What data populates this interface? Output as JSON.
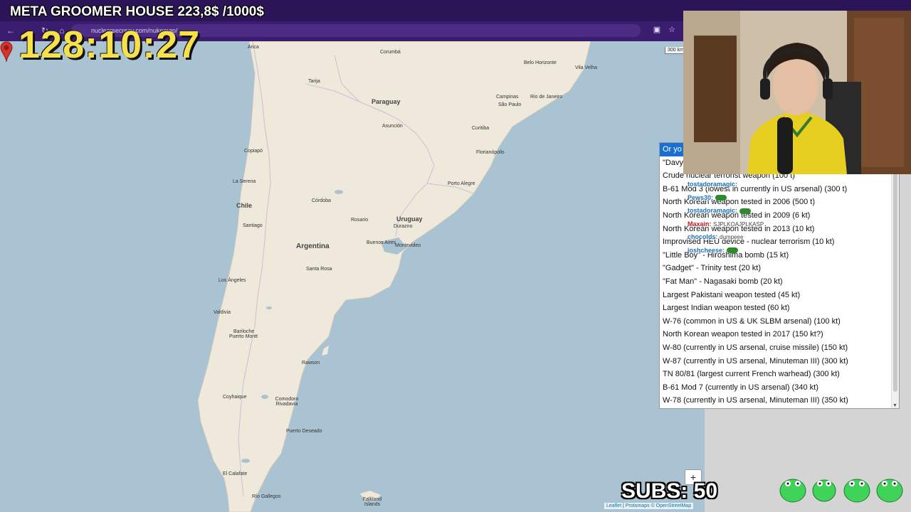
{
  "overlay": {
    "title": "META GROOMER HOUSE 223,8$ /1000$",
    "timer": "128:10:27",
    "subs": "SUBS: 50"
  },
  "browser": {
    "address": "nuclearsecrecy.com/nukemap/"
  },
  "map": {
    "scale": "300 km",
    "zoom_in": "+",
    "attribution": [
      "Leaflet",
      "Protomaps",
      "© OpenStreetMap"
    ],
    "labels": {
      "countries": [
        "Paraguay",
        "Chile",
        "Argentina",
        "Uruguay"
      ],
      "cities": [
        "Arica",
        "Corumbá",
        "Belo Horizonte",
        "Vila Velha",
        "Tarija",
        "Campinas",
        "Rio de Janeiro",
        "São Paulo",
        "Asunción",
        "Curitiba",
        "Copiapó",
        "Florianópolis",
        "La Serena",
        "Córdoba",
        "Porto Alegre",
        "Santiago",
        "Rosario",
        "Durazno",
        "Buenos Aires",
        "Montevideo",
        "Santa Rosa",
        "Los Ángeles",
        "Valdivia",
        "Bariloche",
        "Puerto Montt",
        "Rawson",
        "Coyhaique",
        "Comodoro Rivadavia",
        "Puerto Deseado",
        "El Calafate",
        "Río Gallegos",
        "Falkland Islands"
      ]
    }
  },
  "dropdown": {
    "options": [
      "Or yo",
      "\"Davy",
      "Crude nuclear terrorist weapon (100 t)",
      "B-61 Mod 3 (lowest in currently in US arsenal) (300 t)",
      "North Korean weapon tested in 2006 (500 t)",
      "North Korean weapon tested in 2009 (6 kt)",
      "North Korean weapon tested in 2013 (10 kt)",
      "Improvised HEU device - nuclear terrorism (10 kt)",
      "\"Little Boy\" - Hiroshima bomb (15 kt)",
      "\"Gadget\" - Trinity test (20 kt)",
      "\"Fat Man\" - Nagasaki bomb (20 kt)",
      "Largest Pakistani weapon tested (45 kt)",
      "Largest Indian weapon tested (60 kt)",
      "W-76 (common in US & UK SLBM arsenal) (100 kt)",
      "North Korean weapon tested in 2017 (150 kt?)",
      "W-80 (currently in US arsenal, cruise missile) (150 kt)",
      "W-87 (currently in US arsenal, Minuteman III) (300 kt)",
      "TN 80/81 (largest current French warhead) (300 kt)",
      "B-61 Mod 7 (currently in US arsenal) (340 kt)",
      "W-78 (currently in US arsenal, Minuteman III) (350 kt)"
    ]
  },
  "chat": [
    {
      "user": "tostadoramagic:",
      "text": "",
      "red": false
    },
    {
      "user": "Pews30:",
      "text": "",
      "red": false
    },
    {
      "user": "tostadoramagic:",
      "text": "",
      "red": false
    },
    {
      "user": "Maxain:",
      "text": "SJPLKOAJPLKASP",
      "red": true
    },
    {
      "user": "chocolds:",
      "text": "dumpeee",
      "red": false
    },
    {
      "user": "joshcheese:",
      "text": "",
      "red": false
    }
  ],
  "colors": {
    "land": "#efe9dc",
    "water": "#aac3d2",
    "accent_purple": "#3a1d6e",
    "timer_yellow": "#f6e14b",
    "select_highlight": "#1a6fd0"
  }
}
